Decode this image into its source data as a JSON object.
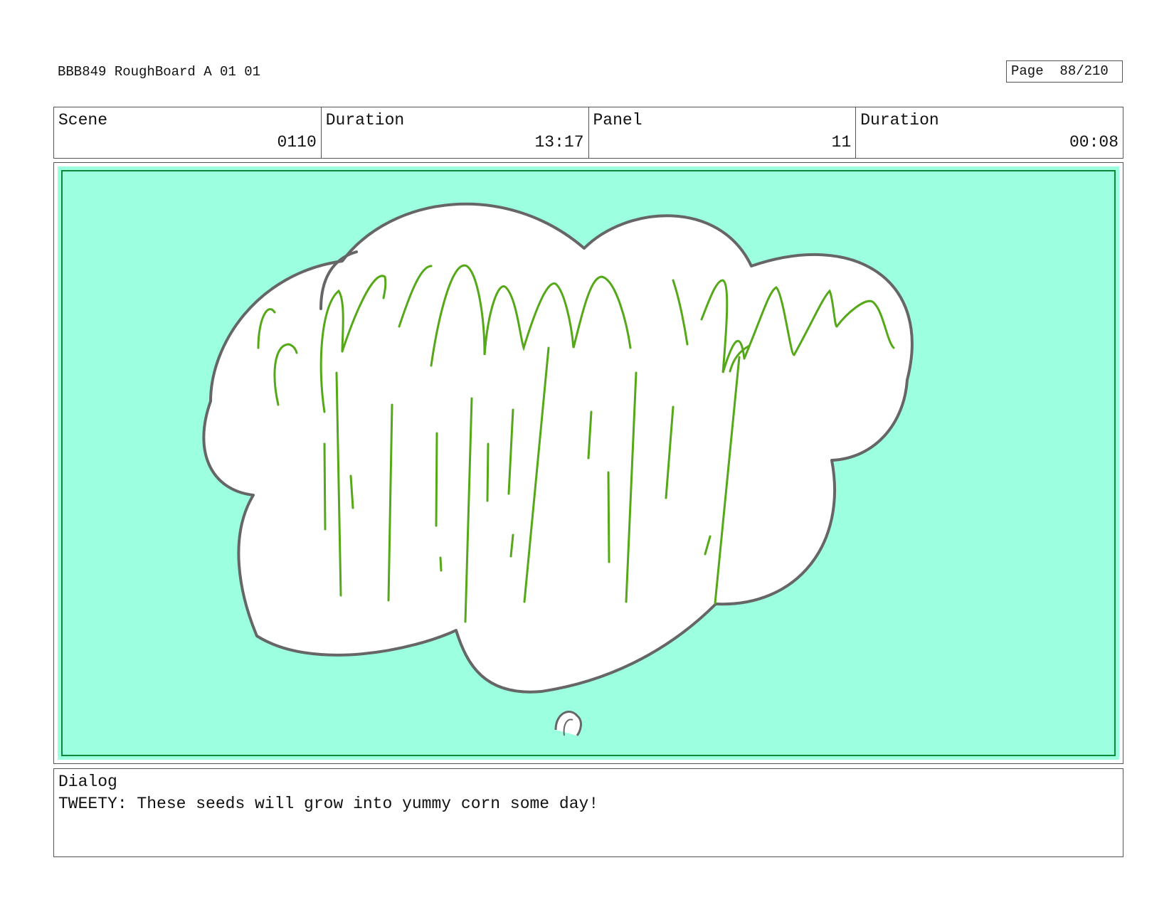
{
  "header": {
    "title": "BBB849 RoughBoard A 01 01",
    "page_label": "Page",
    "page_value": "88/210"
  },
  "info": {
    "scene_label": "Scene",
    "scene_value": "0110",
    "scene_duration_label": "Duration",
    "scene_duration_value": "13:17",
    "panel_label": "Panel",
    "panel_value": "11",
    "panel_duration_label": "Duration",
    "panel_duration_value": "00:08"
  },
  "panel": {
    "background_color": "#9cffe0",
    "border_color": "#0b8a3a",
    "cloud_fill": "#ffffff",
    "cloud_stroke": "#666666",
    "stalk_color": "#55a818"
  },
  "dialog": {
    "label": "Dialog",
    "text": "TWEETY: These seeds will grow into yummy corn some day!"
  }
}
